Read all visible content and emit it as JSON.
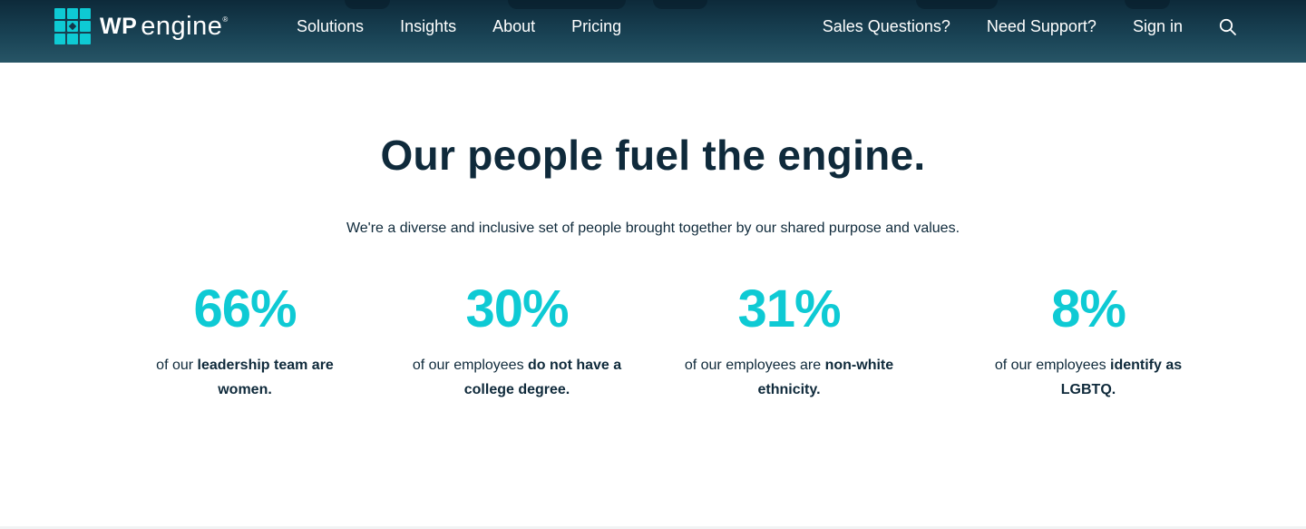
{
  "brand": {
    "wp": "WP",
    "engine": "engine",
    "reg": "®",
    "accent_color": "#0ecad4",
    "nav_bg_color": "#1a4456",
    "text_color": "#0f2a3b"
  },
  "nav": {
    "left": [
      "Solutions",
      "Insights",
      "About",
      "Pricing"
    ],
    "right": [
      "Sales Questions?",
      "Need Support?",
      "Sign in"
    ],
    "search_icon": "search-icon"
  },
  "main": {
    "headline": "Our people fuel the engine.",
    "subtitle": "We're a diverse and inclusive set of people brought together by our shared purpose and values.",
    "stats": [
      {
        "value": "66%",
        "prefix": "of our ",
        "bold": "leadership team are women."
      },
      {
        "value": "30%",
        "prefix": "of our employees ",
        "bold": "do not have a college degree."
      },
      {
        "value": "31%",
        "prefix": "of our employees are ",
        "bold": "non-white ethnicity."
      },
      {
        "value": "8%",
        "prefix": "of our employees ",
        "bold": "identify as LGBTQ."
      }
    ]
  }
}
